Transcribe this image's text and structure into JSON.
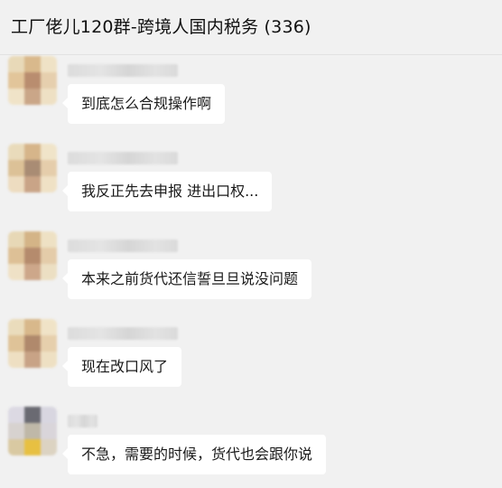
{
  "header": {
    "title": "工厂佬儿120群-跨境人国内税务 (336)"
  },
  "messages": [
    {
      "text": "到底怎么合规操作啊",
      "avatar_colors": [
        "#e8d9b8",
        "#d9b98c",
        "#efe2c6",
        "#e2c59a",
        "#b98d6f",
        "#e6cfae",
        "#f0e3c8",
        "#caa688",
        "#eee0c4"
      ]
    },
    {
      "text": "我反正先去申报 进出口权...",
      "avatar_colors": [
        "#e9dbbb",
        "#d6b58a",
        "#f0e4c9",
        "#dcc197",
        "#a98c74",
        "#e5cdab",
        "#eddcc0",
        "#c9a487",
        "#efe1c5"
      ]
    },
    {
      "text": "本来之前货代还信誓旦旦说没问题",
      "avatar_colors": [
        "#e7d8b6",
        "#d4b487",
        "#eee1c4",
        "#ddc096",
        "#b58b6d",
        "#e4cca9",
        "#efe1c6",
        "#cda78a",
        "#ecdfc3"
      ]
    },
    {
      "text": "现在改口风了",
      "avatar_colors": [
        "#eadcbc",
        "#d8b88b",
        "#f0e3c7",
        "#dfc398",
        "#b0896c",
        "#e6cfac",
        "#eedfc2",
        "#c8a386",
        "#eee0c3"
      ]
    },
    {
      "text": "不急，需要的时候，货代也会跟你说",
      "avatar_colors": [
        "#dcd9e3",
        "#6a6a72",
        "#d8d6e0",
        "#d7d2cf",
        "#bfb8a8",
        "#d9d5da",
        "#d9c9a2",
        "#e7c042",
        "#dcd3c2"
      ]
    }
  ]
}
